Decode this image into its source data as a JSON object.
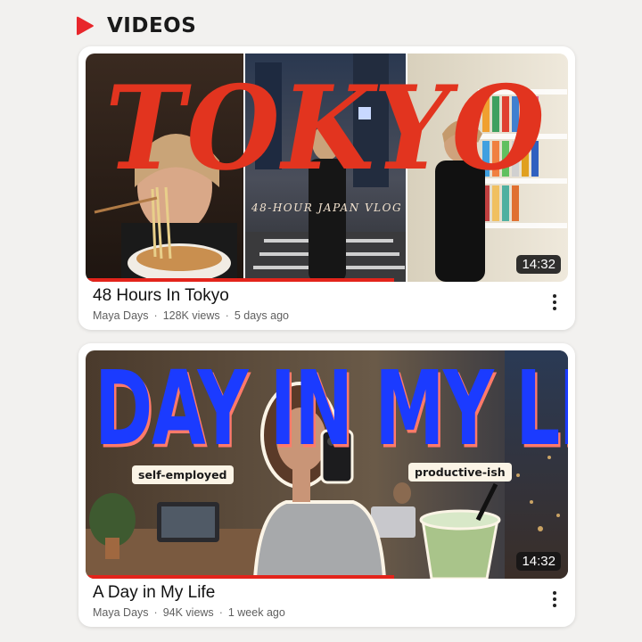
{
  "section": {
    "title": "VIDEOS",
    "icon": "play-icon",
    "icon_color": "#e8262b"
  },
  "videos": [
    {
      "title": "48 Hours In Tokyo",
      "channel": "Maya Days",
      "views": "128K views",
      "age": "5 days ago",
      "duration": "14:32",
      "progress": 0.64,
      "thumb_title": "TOKYO",
      "thumb_subtitle": "48-HOUR JAPAN VLOG"
    },
    {
      "title": "A Day in My Life",
      "channel": "Maya Days",
      "views": "94K views",
      "age": "1 week ago",
      "duration": "14:32",
      "progress": 0.64,
      "thumb_title": "DAY IN MY LIFE",
      "tag_left": "self-employed",
      "tag_right": "productive-ish"
    }
  ],
  "colors": {
    "accent": "#e3241b",
    "card_bg": "#ffffff",
    "page_bg": "#f2f1ef",
    "tokyo_red": "#e2341f",
    "dayinlife_blue": "#1b3bff"
  }
}
